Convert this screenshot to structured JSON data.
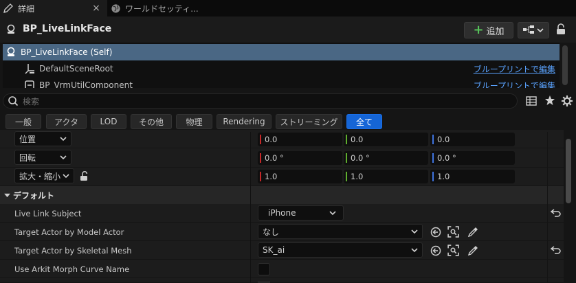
{
  "tabs": [
    {
      "label": "詳細",
      "close": "×"
    },
    {
      "label": "ワールドセッティ..."
    }
  ],
  "header": {
    "title": "BP_LiveLinkFace",
    "add_label": "追加"
  },
  "tree": {
    "rows": [
      {
        "label": "BP_LiveLinkFace (Self)"
      },
      {
        "label": "DefaultSceneRoot",
        "link": "ブループリントで編集"
      },
      {
        "label": "BP_VrmUtilComponent",
        "link": "ブループリントで編集"
      }
    ]
  },
  "search": {
    "placeholder": "検索"
  },
  "filters": [
    "一般",
    "アクタ",
    "LOD",
    "その他",
    "物理",
    "Rendering",
    "ストリーミング",
    "全て"
  ],
  "transform": {
    "location": {
      "label": "位置",
      "x": "0.0",
      "y": "0.0",
      "z": "0.0"
    },
    "rotation": {
      "label": "回転",
      "x": "0.0 °",
      "y": "0.0 °",
      "z": "0.0 °"
    },
    "scale": {
      "label": "拡大・縮小",
      "x": "1.0",
      "y": "1.0",
      "z": "1.0"
    }
  },
  "section": {
    "label": "デフォルト"
  },
  "props": {
    "subject": {
      "label": "Live Link Subject",
      "value": "iPhone"
    },
    "model_actor": {
      "label": "Target Actor by Model Actor",
      "value": "なし"
    },
    "skeletal_mesh": {
      "label": "Target Actor by Skeletal Mesh",
      "value": "SK_ai"
    },
    "arkit": {
      "label": "Use Arkit Morph Curve Name"
    }
  },
  "colors": {
    "x_axis": "#c62828",
    "y_axis": "#5fae2e",
    "z_axis": "#3f74e0",
    "accent": "#1565d6",
    "selected_row": "#4a6784",
    "link": "#5aa3ff"
  }
}
